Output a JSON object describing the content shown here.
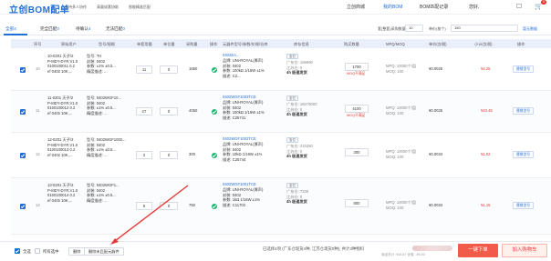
{
  "header": {
    "logo": "立创BOM配单",
    "sub_links": [
      "支持多人协作",
      "高量成套协助",
      "智能精准匹配"
    ],
    "nav": [
      {
        "label": "立创商城",
        "active": false
      },
      {
        "label": "我的BOM",
        "active": true
      },
      {
        "label": "BOM匹配记录",
        "active": false
      },
      {
        "label": "您好,",
        "active": false
      }
    ],
    "cart_count": "0"
  },
  "tabs": [
    {
      "label": "全部",
      "count": "4",
      "active": true
    },
    {
      "label": "完全匹配",
      "count": "0",
      "active": false
    },
    {
      "label": "待确认",
      "count": "4",
      "active": false
    },
    {
      "label": "无法匹配",
      "count": "0",
      "active": false
    }
  ],
  "toolbar": {
    "qty_label": "套(整套)采购数量:",
    "qty_value": "10",
    "sets_label": "单价(按个)",
    "sets_value": "150",
    "link": "暂无数据"
  },
  "columns": [
    "序号",
    "原始用户",
    "型号/规格",
    "单套用量",
    "单位量",
    "采购量",
    "操作",
    "元器件型号/参数/价格/仓库",
    "库存信息",
    "购买数量",
    "MPQ/MOQ",
    "单价(含税)",
    "小计(含税)",
    "操作"
  ],
  "rows": [
    {
      "idx": "10",
      "orig": [
        "10-0201 天子/2",
        "P-MDY-DYR,V1.0",
        "0100100011 0.2",
        "ef 0402 10K,..."
      ],
      "spec": [
        "型号:   TH",
        "封装:   0402",
        "参数:   ±1% ±0.5...",
        "精度描述: ..."
      ],
      "per_set": "11",
      "unit_qty": "0",
      "buy_qty": "1650",
      "part_no": "0402EA...",
      "brand_lines": [
        "品牌: UNI-ROYAL(厚声)",
        "封装: 0402",
        "参数: 100kΩ 1/16W ±1%",
        "描述: C2..."
      ],
      "stock": [
        "支付",
        "广东仓: 169690",
        "江苏仓: 0",
        "4h 极速发货"
      ],
      "qty": "1700",
      "qty_note": "MOQ不满足",
      "mpq": [
        "MPQ: 10000个/盘",
        "MOQ: 100"
      ],
      "unit_price": "¥0.0025",
      "subtotal": "¥4.25",
      "op": "替换型号"
    },
    {
      "idx": "11",
      "orig": [
        "11-0201 天子/2",
        "P-MDY-DYR,V1.0",
        "0100100012 0.2",
        "ef 0402 10K,..."
      ],
      "spec": [
        "型号:   0402WGF10...",
        "封装:   0402",
        "参数:   ±1% ±0.5...",
        "精度描述: ..."
      ],
      "per_set": "27",
      "unit_qty": "0",
      "buy_qty": "4050",
      "part_no": "0402WGF1003TCE",
      "brand_lines": [
        "品牌: UNI-ROYAL(厚声)",
        "封装: 0402",
        "参数: 100kΩ 1/16W ±1%",
        "描述: C25741"
      ],
      "stock": [
        "支付",
        "广东仓: 16079000",
        "江苏仓: 0",
        "4h 极速发货"
      ],
      "qty": "4100",
      "qty_note": "MOQ不满足",
      "mpq": [
        "MPQ: 10000个/盘",
        "MOQ: 100"
      ],
      "unit_price": "¥0.0025",
      "subtotal": "¥10.45",
      "op": "替换型号"
    },
    {
      "idx": "12",
      "orig": [
        "12-0201 天子/2",
        "P-MDY-DYR,V1.0",
        "0100100013 0.2",
        "ef 0402 10K,..."
      ],
      "spec": [
        "型号:   0402WGF1002...",
        "封装:   0402",
        "参数:   ±1% ±0.5...",
        "精度描述: ..."
      ],
      "per_set": "2",
      "unit_qty": "0",
      "buy_qty": "300",
      "part_no": "0402WGF1002TCE",
      "brand_lines": [
        "品牌: UNI-ROYAL(厚声)",
        "封装: 0402",
        "参数: 10kΩ 1/16W ±1%",
        "描述: C25744"
      ],
      "stock": [
        "支付",
        "广东仓: 215280",
        "江苏仓: 0",
        "4h 极速发货"
      ],
      "qty": "300",
      "qty_note": "",
      "mpq": [
        "MPQ: 10000个/盘",
        "MOQ: 100"
      ],
      "unit_price": "¥0.0034",
      "subtotal": "¥1.02",
      "op": "替换型号"
    },
    {
      "idx": "13",
      "orig": [
        "13-0201 天子/2",
        "P-MDY-DYR,V1.0",
        "0100100014 0.2",
        "ef 0402 10K,..."
      ],
      "spec": [
        "型号:   0402WGF1...",
        "封装:   0402",
        "参数:   ±1% ±0.5...",
        "精度描述: ..."
      ],
      "per_set": "5",
      "unit_qty": "0",
      "buy_qty": "750",
      "part_no": "0402WGF1001TCE",
      "brand_lines": [
        "品牌: UNI-ROYAL(厚声)",
        "封装: 0402",
        "参数: 1kΩ 1/16W ±1%",
        "描述: C11702"
      ],
      "stock": [
        "支付",
        "广东仓: 7330",
        "江苏仓: 0",
        "4h 极速发货"
      ],
      "qty": "800",
      "qty_note": "",
      "mpq": [
        "MPQ: 10000个/盘",
        "MOQ: 100"
      ],
      "unit_price": "¥0.0034",
      "subtotal": "¥1.15",
      "op": "替换型号"
    }
  ],
  "bottom": {
    "select_all": "全选",
    "expand": "所有选中",
    "delete": "删除",
    "clear": "删除未匹配元器件",
    "summary": "已选择4项 (广东仓现货4种, 江苏仓现货0种), 共计4种物料",
    "sub_summary": "商品总计: ¥16.87  优惠: -¥0.00",
    "order": "一键下单",
    "add_cart": "加入购物车"
  },
  "colors": {
    "primary": "#1f6fd6",
    "danger": "#e53935",
    "order": "#f25b4a",
    "success": "#22b573"
  }
}
